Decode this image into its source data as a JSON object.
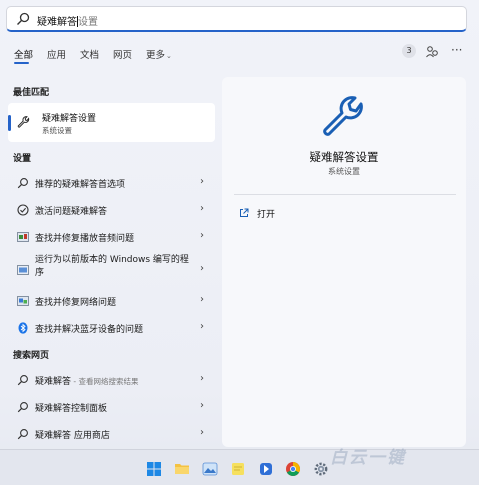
{
  "search": {
    "typed": "疑难解答",
    "rest": "设置"
  },
  "tabs": [
    {
      "label": "全部"
    },
    {
      "label": "应用"
    },
    {
      "label": "文档"
    },
    {
      "label": "网页"
    },
    {
      "label": "更多"
    }
  ],
  "badge_count": "3",
  "more_symbol": "···",
  "best_match": {
    "heading": "最佳匹配",
    "title": "疑难解答设置",
    "subtitle": "系统设置"
  },
  "settings": {
    "heading": "设置",
    "items": [
      {
        "label": "推荐的疑难解答首选项"
      },
      {
        "label": "激活问题疑难解答"
      },
      {
        "label": "查找并修复播放音频问题"
      },
      {
        "label": "运行为以前版本的 Windows 编写的程序"
      },
      {
        "label": "查找并修复网络问题"
      },
      {
        "label": "查找并解决蓝牙设备的问题"
      }
    ]
  },
  "web": {
    "heading": "搜索网页",
    "items": [
      {
        "label": "疑难解答",
        "suffix": " - 查看网络搜索结果"
      },
      {
        "label": "疑难解答控制面板",
        "suffix": ""
      },
      {
        "label": "疑难解答 应用商店",
        "suffix": ""
      }
    ]
  },
  "detail": {
    "title": "疑难解答设置",
    "subtitle": "系统设置",
    "open_label": "打开"
  },
  "watermark": "白云一键",
  "colors": {
    "accent": "#2563c9",
    "icon_blue": "#1a5fb4"
  }
}
